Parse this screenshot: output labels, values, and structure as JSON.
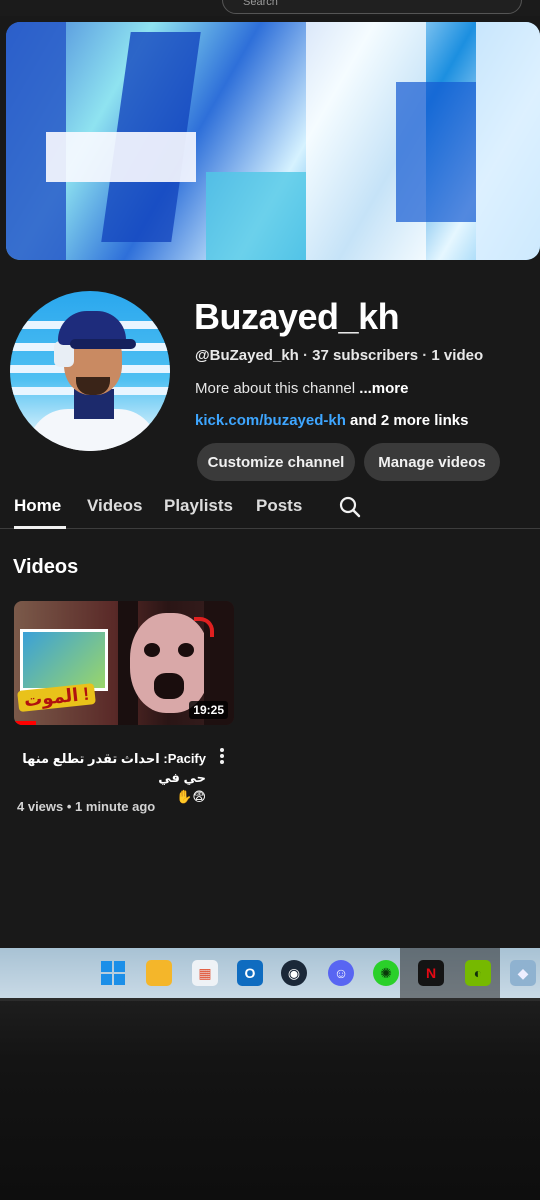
{
  "browser": {
    "search_placeholder": "Search"
  },
  "channel": {
    "name": "Buzayed_kh",
    "handle": "@BuZayed_kh",
    "subscribers": "37 subscribers",
    "videos_count": "1 video",
    "about_text": "More about this channel ",
    "about_more": "...more",
    "link": "kick.com/buzayed-kh",
    "more_links": " and 2 more links"
  },
  "actions": {
    "customize_label": "Customize channel",
    "manage_label": "Manage videos"
  },
  "tabs": [
    {
      "label": "Home",
      "active": true
    },
    {
      "label": "Videos",
      "active": false
    },
    {
      "label": "Playlists",
      "active": false
    },
    {
      "label": "Posts",
      "active": false
    }
  ],
  "section": {
    "title": "Videos"
  },
  "video": {
    "thumb_caption": "الموت !",
    "duration": "19:25",
    "title": "Pacify: احداث تقدر تطلع منها حي في",
    "title_emoji": "😨✋",
    "views": "4 views",
    "age": "1 minute ago",
    "progress": 0.1
  },
  "taskbar": {
    "icons": [
      "windows-start-icon",
      "file-explorer-icon",
      "microsoft-store-icon",
      "outlook-icon",
      "steam-icon",
      "discord-icon",
      "razer-icon",
      "netflix-icon",
      "nvidia-icon",
      "app-icon"
    ]
  },
  "colors": {
    "background": "#191919",
    "link": "#3ea6ff",
    "pill": "#3a3a3a",
    "progress": "#ff0000"
  }
}
